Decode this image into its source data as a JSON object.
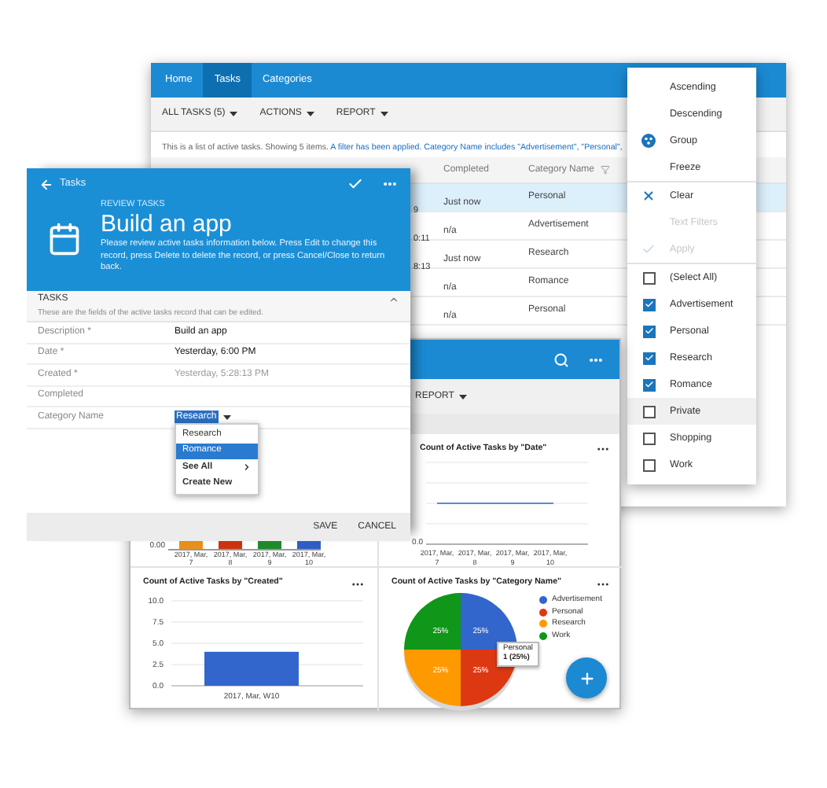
{
  "tasks_window": {
    "nav": [
      {
        "label": "Home",
        "selected": false
      },
      {
        "label": "Tasks",
        "selected": true
      },
      {
        "label": "Categories",
        "selected": false
      }
    ],
    "toolbar": [
      "ALL TASKS (5)",
      "ACTIONS",
      "REPORT"
    ],
    "info_text": "This is a list of active tasks. Showing 5 items.",
    "filter_link": "A filter has been applied. Category Name includes \"Advertisement\", \"Personal\",",
    "columns": [
      "Completed",
      "Category Name"
    ],
    "rows": [
      {
        "column_1": "9",
        "completed": "Just now",
        "category": "Personal",
        "selected": true
      },
      {
        "column_1": "0:11",
        "completed": "n/a",
        "category": "Advertisement",
        "selected": false
      },
      {
        "column_1": "8:13",
        "completed": "Just now",
        "category": "Research",
        "selected": false
      },
      {
        "completed": "n/a",
        "category": "Romance",
        "selected": false
      },
      {
        "completed": "n/a",
        "category": "Personal",
        "selected": false
      }
    ]
  },
  "column_menu": {
    "actions": [
      {
        "kind": "plain",
        "label": "Ascending",
        "disabled": false
      },
      {
        "kind": "plain",
        "label": "Descending",
        "disabled": false
      },
      {
        "kind": "group",
        "label": "Group",
        "disabled": false
      },
      {
        "kind": "plain",
        "label": "Freeze",
        "disabled": false
      },
      {
        "kind": "divider"
      },
      {
        "kind": "clear",
        "label": "Clear",
        "disabled": false
      },
      {
        "kind": "plain",
        "label": "Text Filters",
        "disabled": true
      },
      {
        "kind": "apply",
        "label": "Apply",
        "disabled": true
      }
    ],
    "values": [
      {
        "label": "(Select All)",
        "checked": false,
        "highlighted": false
      },
      {
        "label": "Advertisement",
        "checked": true,
        "highlighted": false
      },
      {
        "label": "Personal",
        "checked": true,
        "highlighted": false
      },
      {
        "label": "Research",
        "checked": true,
        "highlighted": false
      },
      {
        "label": "Romance",
        "checked": true,
        "highlighted": false
      },
      {
        "label": "Private",
        "checked": false,
        "highlighted": true
      },
      {
        "label": "Shopping",
        "checked": false,
        "highlighted": false
      },
      {
        "label": "Work",
        "checked": false,
        "highlighted": false
      }
    ]
  },
  "dashboard": {
    "report_menu": "REPORT",
    "charts": [
      {
        "kind": "bars_partial",
        "y_tick": "0.00",
        "bars": [
          {
            "label": "2017, Mar, 7",
            "color": "#e8901a"
          },
          {
            "label": "2017, Mar, 8",
            "color": "#cc3311"
          },
          {
            "label": "2017, Mar, 9",
            "color": "#1e8a2a"
          },
          {
            "label": "2017, Mar, 10",
            "color": "#2f5fc4"
          }
        ]
      },
      {
        "kind": "line",
        "title": "Count of Active Tasks by \"Date\"",
        "y_tick": "0.0",
        "x_labels": [
          "2017, Mar, 7",
          "2017, Mar, 8",
          "2017, Mar, 9",
          "2017, Mar, 10"
        ]
      },
      {
        "chart_data": {
          "type": "bar",
          "title": "Count of Active Tasks by \"Created\"",
          "categories": [
            "2017, Mar, W10"
          ],
          "series": [
            {
              "color": "#3366cc",
              "values": [
                4
              ]
            }
          ],
          "grid": true,
          "ylim": [
            0,
            10
          ],
          "yticks": [
            {
              "value": 0,
              "label": "0.0"
            },
            {
              "value": 2.5,
              "label": "2.5"
            },
            {
              "value": 5,
              "label": "5.0"
            },
            {
              "value": 7.5,
              "label": "7.5"
            },
            {
              "value": 10,
              "label": "10.0"
            }
          ]
        }
      },
      {
        "chart_data": {
          "type": "pie",
          "title": "Count of Active Tasks by \"Category Name\"",
          "categories": [
            "Advertisement",
            "Personal",
            "Research",
            "Work"
          ],
          "values": [
            25,
            25,
            25,
            25
          ],
          "value_labels": [
            "25%",
            "25%",
            "25%",
            "25%"
          ],
          "legend": "right"
        },
        "legend_items": [
          {
            "color": "#3366cc"
          },
          {
            "color": "#dc3912"
          },
          {
            "color": "#ff9900"
          },
          {
            "color": "#109618"
          }
        ],
        "tooltip": {
          "title": "Personal",
          "value": "1 (25%)"
        }
      }
    ]
  },
  "review_dialog": {
    "back_label": "Tasks",
    "eyebrow": "REVIEW TASKS",
    "title": "Build an app",
    "description": "Please review active tasks information below. Press Edit to change this record, press Delete to delete the record, or press Cancel/Close to return back.",
    "section": {
      "title": "TASKS",
      "expanded": true,
      "subtitle": "These are the fields of the active tasks record that can be edited."
    },
    "fields": [
      {
        "label": "Description *",
        "value": "Build an app",
        "muted": false
      },
      {
        "label": "Date *",
        "value": "Yesterday, 6:00 PM",
        "muted": false
      },
      {
        "label": "Created *",
        "value": "Yesterday, 5:28:13 PM",
        "muted": true
      },
      {
        "label": "Completed"
      },
      {
        "label": "Category Name",
        "value": "Research",
        "kind": "lookup"
      }
    ],
    "lookup_menu": [
      {
        "kind": "option",
        "label": "Research",
        "selected": false
      },
      {
        "kind": "option",
        "label": "Romance",
        "selected": true
      },
      {
        "kind": "submenu",
        "label": "See All",
        "selected": false
      },
      {
        "kind": "command",
        "label": "Create New",
        "selected": false
      }
    ],
    "buttons": [
      "SAVE",
      "CANCEL"
    ]
  }
}
